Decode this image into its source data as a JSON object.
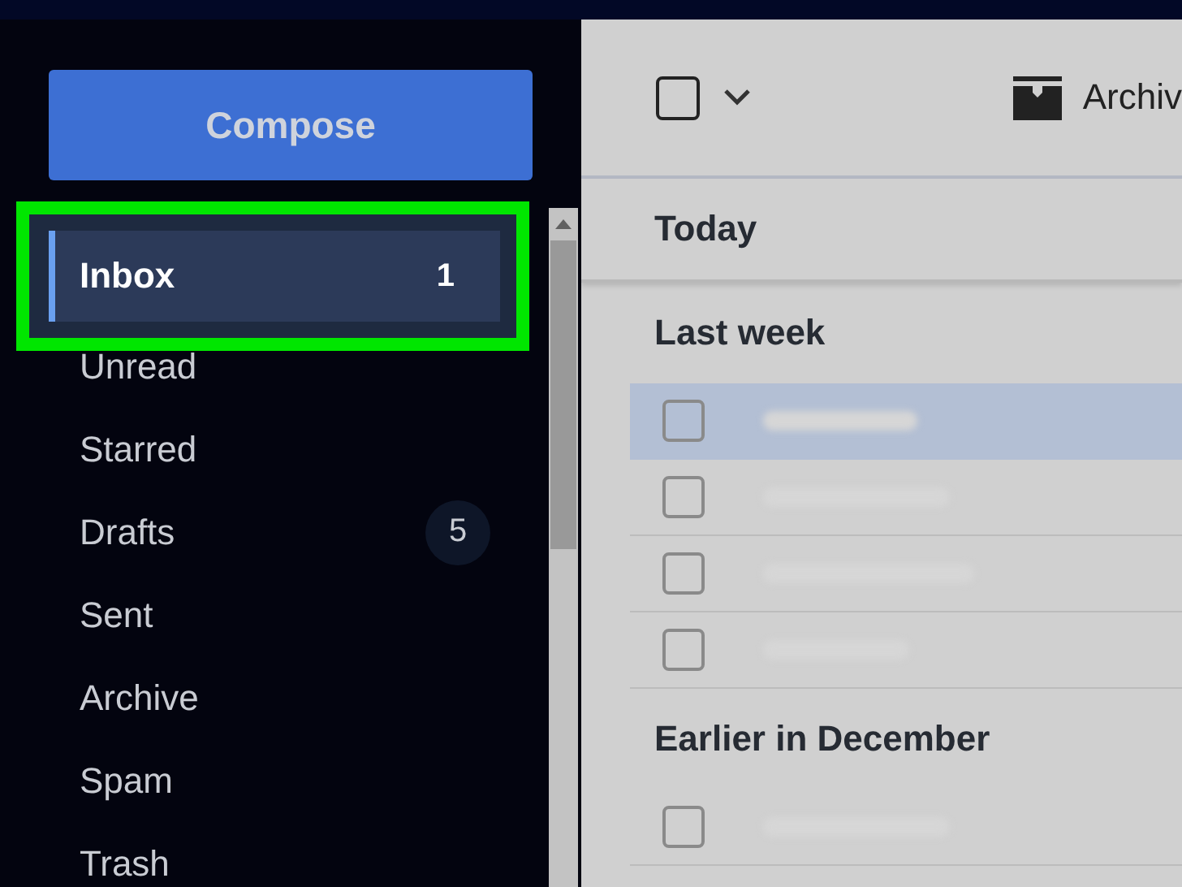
{
  "sidebar": {
    "compose": "Compose",
    "folders": [
      {
        "label": "Inbox",
        "count": "1",
        "selected": true,
        "highlighted": true
      },
      {
        "label": "Unread",
        "selected": false,
        "highlighted": false
      },
      {
        "label": "Starred",
        "selected": false,
        "highlighted": false
      },
      {
        "label": "Drafts",
        "count": "5",
        "selected": false,
        "highlighted": false
      },
      {
        "label": "Sent",
        "selected": false,
        "highlighted": false
      },
      {
        "label": "Archive",
        "selected": false,
        "highlighted": false
      },
      {
        "label": "Spam",
        "selected": false,
        "highlighted": false
      },
      {
        "label": "Trash",
        "selected": false,
        "highlighted": false
      }
    ]
  },
  "toolbar": {
    "select_all_checked": false,
    "archive_label": "Archiv"
  },
  "sections": [
    {
      "title": "Today"
    },
    {
      "title": "Last week",
      "emails": [
        {
          "selected": true,
          "checked": false
        },
        {
          "selected": false,
          "checked": false
        },
        {
          "selected": false,
          "checked": false
        },
        {
          "selected": false,
          "checked": false
        }
      ]
    },
    {
      "title": "Earlier in December",
      "emails": [
        {
          "selected": false,
          "checked": false
        }
      ]
    }
  ]
}
